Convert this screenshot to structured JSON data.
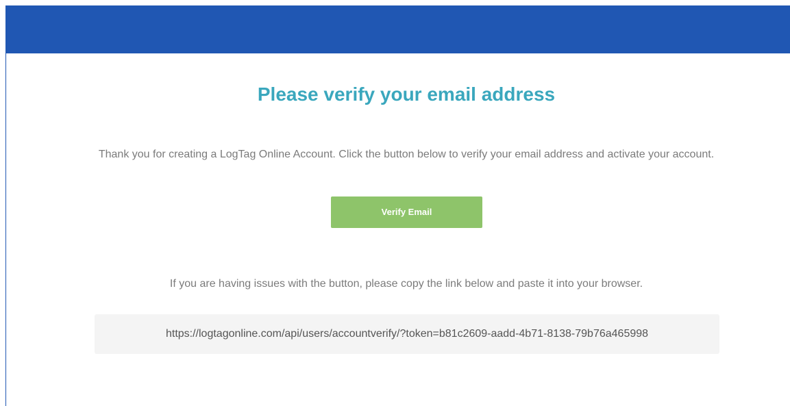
{
  "email": {
    "title": "Please verify your email address",
    "intro": "Thank you for creating a LogTag Online Account. Click the button below to verify your email address and activate your account.",
    "verify_button_label": "Verify Email",
    "help_text": "If you are having issues with the button, please copy the link below and paste it into your browser.",
    "verify_link": "https://logtagonline.com/api/users/accountverify/?token=b81c2609-aadd-4b71-8138-79b76a465998"
  },
  "colors": {
    "header": "#2057b3",
    "title": "#3aa7bd",
    "button": "#8ec46a",
    "body_text": "#7b7b7b",
    "link_box": "#f4f4f4"
  }
}
